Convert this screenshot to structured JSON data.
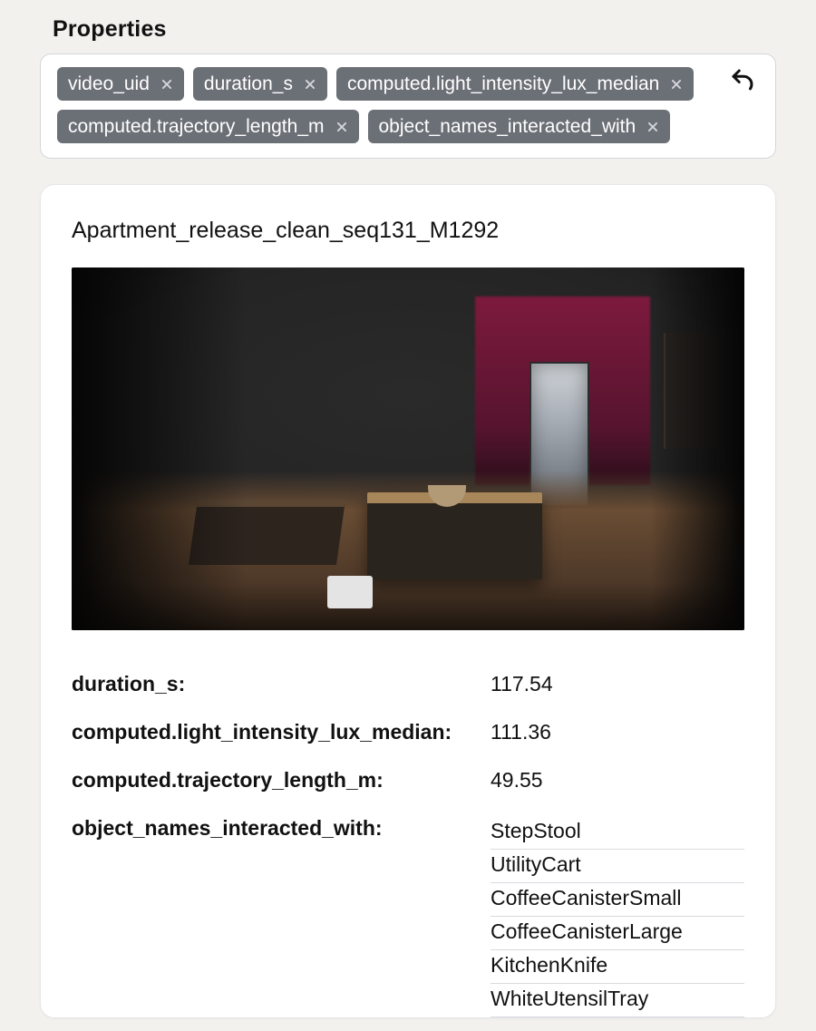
{
  "section_title": "Properties",
  "filter_chips": [
    {
      "label": "video_uid"
    },
    {
      "label": "duration_s"
    },
    {
      "label": "computed.light_intensity_lux_median"
    },
    {
      "label": "computed.trajectory_length_m"
    },
    {
      "label": "object_names_interacted_with"
    }
  ],
  "card": {
    "title": "Apartment_release_clean_seq131_M1292",
    "rows": [
      {
        "key": "duration_s:",
        "value": "117.54"
      },
      {
        "key": "computed.light_intensity_lux_median:",
        "value": "111.36"
      },
      {
        "key": "computed.trajectory_length_m:",
        "value": "49.55"
      }
    ],
    "objects_key": "object_names_interacted_with:",
    "objects": [
      "StepStool",
      "UtilityCart",
      "CoffeeCanisterSmall",
      "CoffeeCanisterLarge",
      "KitchenKnife",
      "WhiteUtensilTray"
    ]
  }
}
